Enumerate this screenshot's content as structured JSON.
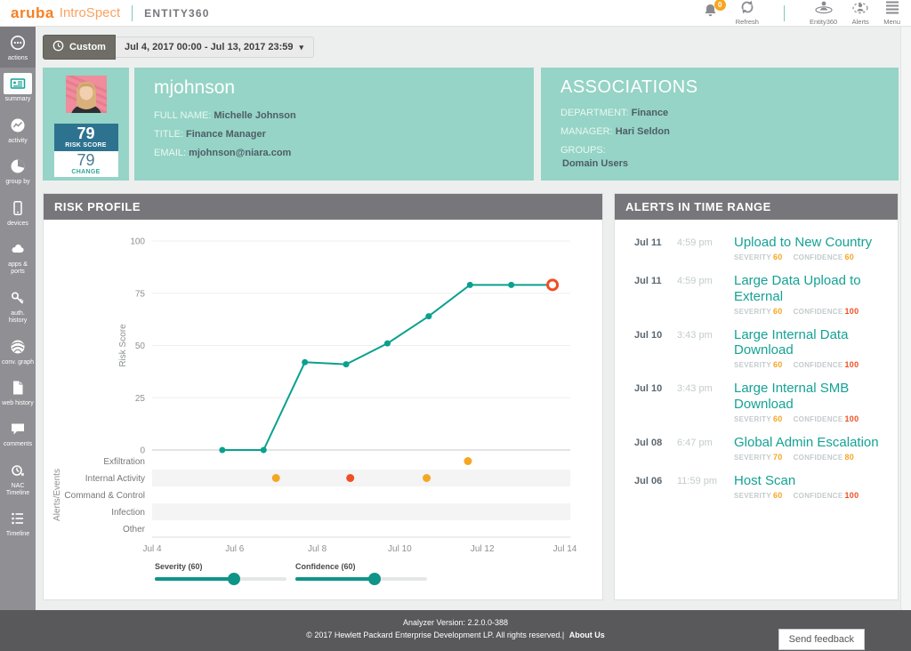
{
  "topbar": {
    "brand": "aruba",
    "product": "IntroSpect",
    "section": "ENTITY360",
    "notification_count": "0",
    "actions": [
      {
        "label": "Refresh",
        "icon": "refresh-icon"
      },
      {
        "label": "Entity360",
        "icon": "entity360-icon"
      },
      {
        "label": "Alerts",
        "icon": "alerts-icon"
      },
      {
        "label": "Menu",
        "icon": "menu-icon"
      }
    ]
  },
  "timebar": {
    "mode_label": "Custom",
    "range": "Jul 4, 2017 00:00 - Jul 13, 2017 23:59"
  },
  "sidebar": {
    "items": [
      {
        "label": "actions",
        "icon": "actions-icon",
        "selected": false
      },
      {
        "label": "summary",
        "icon": "summary-icon",
        "selected": true
      },
      {
        "label": "activity",
        "icon": "activity-icon",
        "selected": false
      },
      {
        "label": "group by",
        "icon": "group-by-icon",
        "selected": false
      },
      {
        "label": "devices",
        "icon": "devices-icon",
        "selected": false
      },
      {
        "label": "apps & ports",
        "icon": "apps-ports-icon",
        "selected": false
      },
      {
        "label": "auth. history",
        "icon": "auth-history-icon",
        "selected": false
      },
      {
        "label": "conv. graph",
        "icon": "conv-graph-icon",
        "selected": false
      },
      {
        "label": "web history",
        "icon": "web-history-icon",
        "selected": false
      },
      {
        "label": "comments",
        "icon": "comments-icon",
        "selected": false
      },
      {
        "label": "NAC Timeline",
        "icon": "nac-timeline-icon",
        "selected": false
      },
      {
        "label": "Timeline",
        "icon": "timeline-icon",
        "selected": false
      }
    ]
  },
  "user_card": {
    "username": "mjohnson",
    "risk_score": "79",
    "risk_score_label": "RISK SCORE",
    "change": "79",
    "change_label": "CHANGE",
    "fields": [
      {
        "label": "FULL NAME:",
        "value": "Michelle Johnson"
      },
      {
        "label": "TITLE:",
        "value": "Finance Manager"
      },
      {
        "label": "EMAIL:",
        "value": "mjohnson@niara.com"
      }
    ]
  },
  "associations": {
    "title": "ASSOCIATIONS",
    "fields": [
      {
        "label": "DEPARTMENT:",
        "value": "Finance",
        "stacked": false
      },
      {
        "label": "MANAGER:",
        "value": "Hari Seldon",
        "stacked": false
      },
      {
        "label": "GROUPS:",
        "value": "Domain Users",
        "stacked": true
      }
    ]
  },
  "risk_profile": {
    "title": "RISK PROFILE"
  },
  "chart_data": {
    "type": "line",
    "title": "RISK PROFILE",
    "ylabel": "Risk Score",
    "events_label": "Alerts/Events",
    "x_range": [
      4,
      14
    ],
    "x_ticks": [
      {
        "label": "Jul 4",
        "x": 4
      },
      {
        "label": "Jul 6",
        "x": 6
      },
      {
        "label": "Jul 8",
        "x": 8
      },
      {
        "label": "Jul 10",
        "x": 10
      },
      {
        "label": "Jul 12",
        "x": 12
      },
      {
        "label": "Jul 14",
        "x": 14
      }
    ],
    "ylim": [
      0,
      100
    ],
    "y_ticks": [
      0,
      25,
      50,
      75,
      100
    ],
    "series": [
      {
        "name": "Risk Score",
        "x": [
          5.7,
          6.7,
          7.7,
          8.7,
          9.7,
          10.7,
          11.7,
          12.7,
          13.7
        ],
        "y": [
          0,
          0,
          42,
          41,
          51,
          64,
          79,
          79,
          79
        ]
      }
    ],
    "current_point": {
      "x": 13.7,
      "y": 79
    },
    "event_rows": [
      {
        "label": "Exfiltration",
        "events": [
          {
            "x": 11.65,
            "color": "#f5a623"
          }
        ]
      },
      {
        "label": "Internal Activity",
        "events": [
          {
            "x": 7.0,
            "color": "#f5a623"
          },
          {
            "x": 8.8,
            "color": "#f04e23"
          },
          {
            "x": 10.65,
            "color": "#f5a623"
          }
        ]
      },
      {
        "label": "Command & Control",
        "events": []
      },
      {
        "label": "Infection",
        "events": []
      },
      {
        "label": "Other",
        "events": []
      }
    ],
    "sliders": [
      {
        "label": "Severity (60)",
        "value": 60,
        "max": 100
      },
      {
        "label": "Confidence (60)",
        "value": 60,
        "max": 100
      }
    ],
    "line_color": "#0aa08e",
    "highlight_color": "#f04e23",
    "band_color": "#f4f4f4"
  },
  "alerts_panel": {
    "title": "ALERTS IN TIME RANGE",
    "severity_label": "SEVERITY",
    "confidence_label": "CONFIDENCE",
    "alerts": [
      {
        "date": "Jul 11",
        "time": "4:59 pm",
        "title": "Upload to New Country",
        "severity": "60",
        "confidence": "60",
        "severity_color": "#f5a623",
        "confidence_color": "#f5a623"
      },
      {
        "date": "Jul 11",
        "time": "4:59 pm",
        "title": "Large Data Upload to External",
        "severity": "60",
        "confidence": "100",
        "severity_color": "#f5a623",
        "confidence_color": "#f04e23"
      },
      {
        "date": "Jul 10",
        "time": "3:43 pm",
        "title": "Large Internal Data Download",
        "severity": "60",
        "confidence": "100",
        "severity_color": "#f5a623",
        "confidence_color": "#f04e23"
      },
      {
        "date": "Jul 10",
        "time": "3:43 pm",
        "title": "Large Internal SMB Download",
        "severity": "60",
        "confidence": "100",
        "severity_color": "#f5a623",
        "confidence_color": "#f04e23"
      },
      {
        "date": "Jul 08",
        "time": "6:47 pm",
        "title": "Global Admin Escalation",
        "severity": "70",
        "confidence": "80",
        "severity_color": "#f5a623",
        "confidence_color": "#f5a623"
      },
      {
        "date": "Jul 06",
        "time": "11:59 pm",
        "title": "Host Scan",
        "severity": "60",
        "confidence": "100",
        "severity_color": "#f5a623",
        "confidence_color": "#f04e23"
      }
    ]
  },
  "footer": {
    "version": "Analyzer Version: 2.2.0.0-388",
    "copyright": "© 2017 Hewlett Packard Enterprise Development LP. All rights reserved.|",
    "about": "About Us",
    "feedback_button": "Send feedback"
  },
  "colors": {
    "accent_teal": "#0aa08e",
    "orange": "#f5a623",
    "red": "#f04e23",
    "card_teal": "#95d4c6",
    "score_box_blue": "#2d7390",
    "header_gray": "#77777b",
    "brand_orange": "#f58025",
    "footer_gray": "#59595b"
  }
}
